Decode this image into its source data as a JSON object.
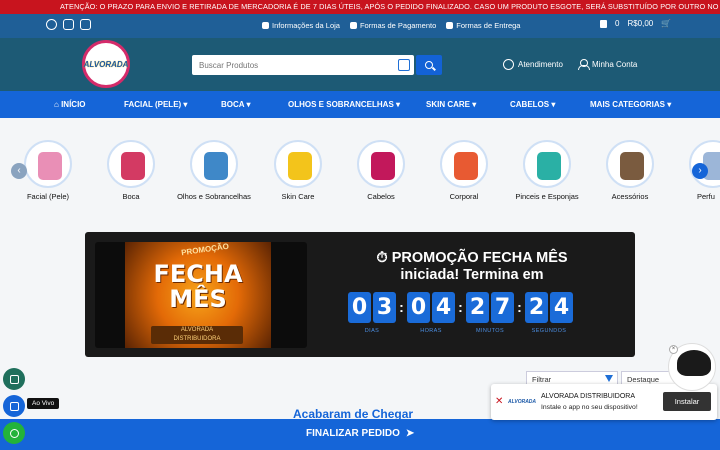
{
  "announcement": "ATENÇÃO: O PRAZO PARA ENVIO E RETIRADA DE MERCADORIA É DE 7 DIAS ÚTEIS, APÓS O PEDIDO FINALIZADO. CASO UM PRODUTO ESGOTE, SERÁ SUBSTITUÍDO POR OUTRO NO MESMO VALOR.    ATEN",
  "topbar": {
    "social_icons": [
      "whatsapp-icon",
      "facebook-icon",
      "instagram-icon"
    ],
    "links": [
      "Informações da Loja",
      "Formas de Pagamento",
      "Formas de Entrega"
    ],
    "cart_count": "0",
    "cart_total": "R$0,00"
  },
  "header": {
    "logo_text": "ALVORADA",
    "search_placeholder": "Buscar Produtos",
    "atendimento": "Atendimento",
    "minha_conta": "Minha Conta"
  },
  "nav": [
    {
      "label": "INÍCIO"
    },
    {
      "label": "FACIAL (PELE)"
    },
    {
      "label": "BOCA"
    },
    {
      "label": "OLHOS E SOBRANCELHAS"
    },
    {
      "label": "SKIN CARE"
    },
    {
      "label": "CABELOS"
    },
    {
      "label": "MAIS CATEGORIAS"
    }
  ],
  "categories": [
    {
      "label": "Facial (Pele)",
      "color": "#e98fb6"
    },
    {
      "label": "Boca",
      "color": "#d33a63"
    },
    {
      "label": "Olhos e Sobrancelhas",
      "color": "#3f88c8"
    },
    {
      "label": "Skin Care",
      "color": "#f3c41b"
    },
    {
      "label": "Cabelos",
      "color": "#c2185b"
    },
    {
      "label": "Corporal",
      "color": "#e85a32"
    },
    {
      "label": "Pinceis e Esponjas",
      "color": "#2ab0a5"
    },
    {
      "label": "Acessórios",
      "color": "#7a5b3f"
    },
    {
      "label": "Perfu",
      "color": "#9cb6d8"
    }
  ],
  "promo": {
    "image_title": "FECHA MÊS",
    "image_tag": "PROMOÇÃO",
    "image_badge_line1": "ALVORADA",
    "image_badge_line2": "DISTRIBUIDORA",
    "title": "⏱ PROMOÇÃO FECHA MÊS iniciada! Termina em",
    "timer": {
      "dias": [
        "0",
        "3"
      ],
      "horas": [
        "0",
        "4"
      ],
      "minutos": [
        "2",
        "7"
      ],
      "segundos": [
        "2",
        "4"
      ],
      "labels": {
        "dias": "DIAS",
        "horas": "HORAS",
        "minutos": "MINUTOS",
        "segundos": "SEGUNDOS"
      }
    }
  },
  "filters": {
    "filtrar": "Filtrar",
    "destaque": "Destaque"
  },
  "section_heading": "Acabaram de Chegar",
  "bottombar": {
    "finalizar": "FINALIZAR PEDIDO"
  },
  "live_label": "Ao Vivo",
  "install_popup": {
    "app_name": "ALVORADA DISTRIBUIDORA",
    "subtitle": "Instale o app no seu dispositivo!",
    "button": "Instalar",
    "logo_text": "ALVORADA"
  },
  "colors": {
    "brand_blue": "#1565d8",
    "header_teal": "#1d5a75",
    "alert_red": "#c8141e",
    "whatsapp_green": "#23b33a"
  }
}
